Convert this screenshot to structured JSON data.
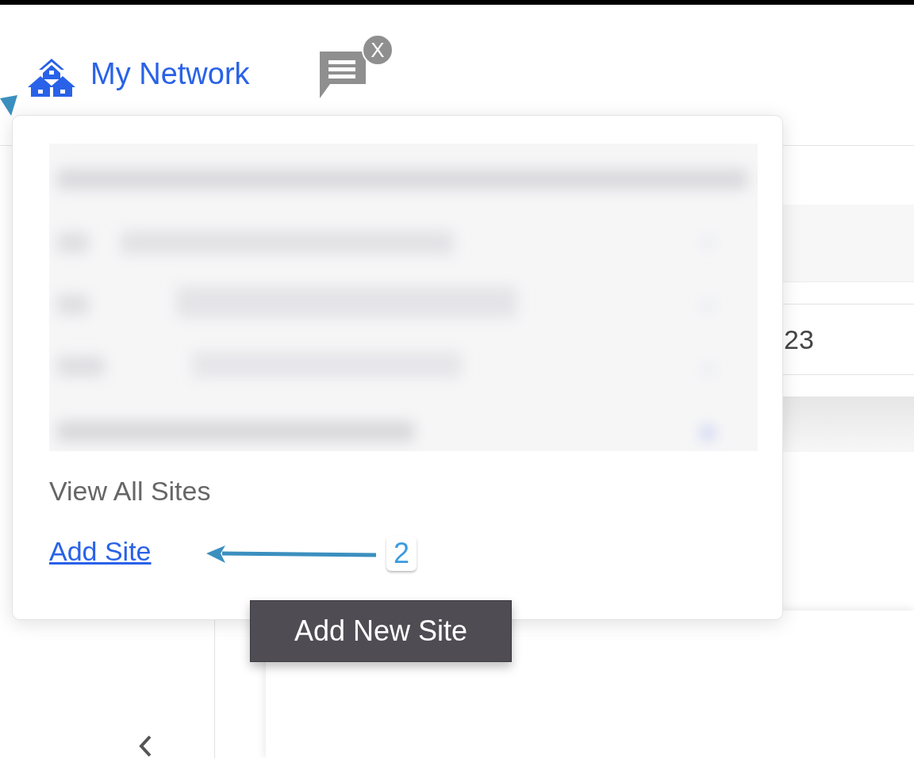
{
  "header": {
    "network_link": "My Network",
    "chat_badge": "X"
  },
  "popover": {
    "view_all": "View All Sites",
    "add_site": "Add Site"
  },
  "annotation": {
    "step": "2"
  },
  "tooltip": "Add New Site",
  "background": {
    "cell": "23"
  }
}
